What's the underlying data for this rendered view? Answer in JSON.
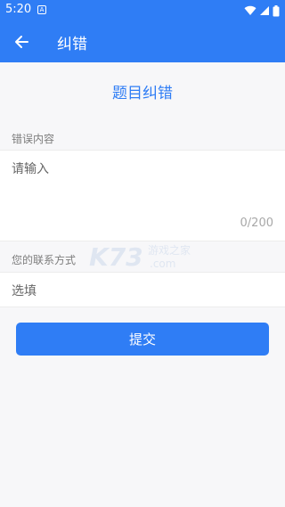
{
  "status_bar": {
    "time": "5:20",
    "notification_badge": "A"
  },
  "app_bar": {
    "title": "纠错",
    "back_icon": "arrow-back-icon"
  },
  "page": {
    "heading": "题目纠错"
  },
  "error_content": {
    "label": "错误内容",
    "placeholder": "请输入",
    "counter": "0/200"
  },
  "contact": {
    "label": "您的联系方式",
    "placeholder": "选填"
  },
  "submit": {
    "label": "提交"
  },
  "watermark": {
    "brand": "K73",
    "sub": "游戏之家",
    "domain": ".com"
  },
  "colors": {
    "primary": "#2f7df5",
    "background": "#f7f7f9",
    "label_text": "#7d7d7d"
  }
}
